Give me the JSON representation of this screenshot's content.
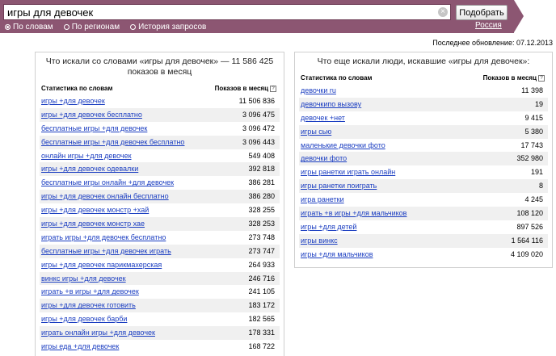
{
  "search": {
    "query": "игры для девочек",
    "submit_label": "Подобрать",
    "clear_glyph": "×"
  },
  "modes": [
    {
      "label": "По словам",
      "checked": true
    },
    {
      "label": "По регионам",
      "checked": false
    },
    {
      "label": "История запросов",
      "checked": false
    }
  ],
  "region": "Россия",
  "updated": "Последнее обновление: 07.12.2013",
  "left_panel": {
    "title_line1": "Что искали со словами «игры для девочек» — 11 586 425",
    "title_line2": "показов в месяц",
    "col_keyword": "Статистика по словам",
    "col_shows": "Показов в месяц",
    "rows": [
      {
        "kw": "игры +для девочек",
        "n": "11 506 836"
      },
      {
        "kw": "игры +для девочек бесплатно",
        "n": "3 096 475"
      },
      {
        "kw": "бесплатные игры +для девочек",
        "n": "3 096 472"
      },
      {
        "kw": "бесплатные игры +для девочек бесплатно",
        "n": "3 096 443"
      },
      {
        "kw": "онлайн игры +для девочек",
        "n": "549 408"
      },
      {
        "kw": "игры +для девочек одевалки",
        "n": "392 818"
      },
      {
        "kw": "бесплатные игры онлайн +для девочек",
        "n": "386 281"
      },
      {
        "kw": "игры +для девочек онлайн бесплатно",
        "n": "386 280"
      },
      {
        "kw": "игры +для девочек монстр +хай",
        "n": "328 255"
      },
      {
        "kw": "игры +для девочек монстр хае",
        "n": "328 253"
      },
      {
        "kw": "играть игры +для девочек бесплатно",
        "n": "273 748"
      },
      {
        "kw": "бесплатные игры +для девочек играть",
        "n": "273 747"
      },
      {
        "kw": "игры +для девочек парикмахерская",
        "n": "264 933"
      },
      {
        "kw": "винкс игры +для девочек",
        "n": "246 716"
      },
      {
        "kw": "играть +в игры +для девочек",
        "n": "241 105"
      },
      {
        "kw": "игры +для девочек готовить",
        "n": "183 172"
      },
      {
        "kw": "игры +для девочек барби",
        "n": "182 565"
      },
      {
        "kw": "играть онлайн игры +для девочек",
        "n": "178 331"
      },
      {
        "kw": "игры еда +для девочек",
        "n": "168 722"
      }
    ]
  },
  "right_panel": {
    "title": "Что еще искали люди, искавшие «игры для девочек»:",
    "col_keyword": "Статистика по словам",
    "col_shows": "Показов в месяц",
    "rows": [
      {
        "kw": "девочки ru",
        "n": "11 398"
      },
      {
        "kw": "девочкипо вызову",
        "n": "19"
      },
      {
        "kw": "девочек +нет",
        "n": "9 415"
      },
      {
        "kw": "игры сью",
        "n": "5 380"
      },
      {
        "kw": "маленькие девочки фото",
        "n": "17 743"
      },
      {
        "kw": "девочки фото",
        "n": "352 980"
      },
      {
        "kw": "игры ранетки играть онлайн",
        "n": "191"
      },
      {
        "kw": "игры ранетки поиграть",
        "n": "8"
      },
      {
        "kw": "игра ранетки",
        "n": "4 245"
      },
      {
        "kw": "играть +в игры +для мальчиков",
        "n": "108 120"
      },
      {
        "kw": "игры +для детей",
        "n": "897 526"
      },
      {
        "kw": "игры винкс",
        "n": "1 564 116"
      },
      {
        "kw": "игры +для мальчиков",
        "n": "4 109 020"
      }
    ]
  }
}
